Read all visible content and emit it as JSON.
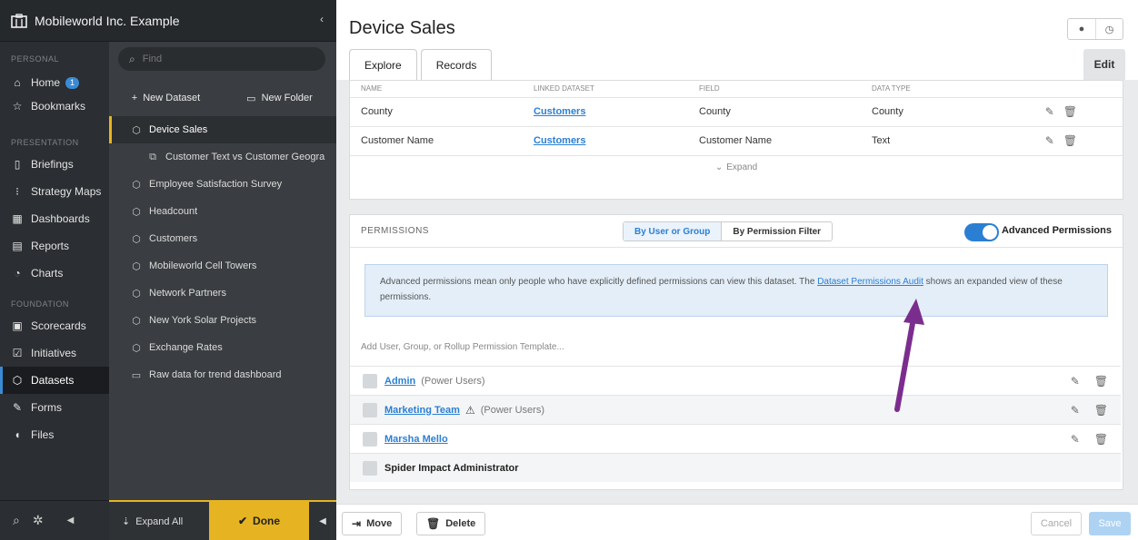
{
  "app": {
    "org_name": "Mobileworld Inc. Example"
  },
  "nav": {
    "sections": {
      "personal": "PERSONAL",
      "presentation": "PRESENTATION",
      "foundation": "FOUNDATION"
    },
    "items": [
      {
        "label": "Home",
        "icon": "home-icon",
        "badge": "1"
      },
      {
        "label": "Bookmarks",
        "icon": "star-icon"
      },
      {
        "label": "Briefings",
        "icon": "book-icon"
      },
      {
        "label": "Strategy Maps",
        "icon": "strategy-map-icon"
      },
      {
        "label": "Dashboards",
        "icon": "dashboard-icon"
      },
      {
        "label": "Reports",
        "icon": "report-icon"
      },
      {
        "label": "Charts",
        "icon": "chart-icon"
      },
      {
        "label": "Scorecards",
        "icon": "scorecard-icon"
      },
      {
        "label": "Initiatives",
        "icon": "checkbox-icon"
      },
      {
        "label": "Datasets",
        "icon": "dataset-icon",
        "active": true
      },
      {
        "label": "Forms",
        "icon": "form-icon"
      },
      {
        "label": "Files",
        "icon": "file-icon"
      }
    ]
  },
  "tree": {
    "search_placeholder": "Find",
    "new_dataset": "New Dataset",
    "new_folder": "New Folder",
    "items": [
      {
        "label": "Device Sales",
        "selected": true
      },
      {
        "label": "Customer Text vs Customer Geogra",
        "child": true
      },
      {
        "label": "Employee Satisfaction Survey"
      },
      {
        "label": "Headcount"
      },
      {
        "label": "Customers"
      },
      {
        "label": "Mobileworld Cell Towers"
      },
      {
        "label": "Network Partners"
      },
      {
        "label": "New York Solar Projects"
      },
      {
        "label": "Exchange Rates"
      },
      {
        "label": "Raw data for trend dashboard",
        "folder": true
      }
    ],
    "expand_all": "Expand All",
    "done": "Done"
  },
  "main": {
    "title": "Device Sales",
    "tabs": [
      "Explore",
      "Records"
    ],
    "edit": "Edit",
    "fields_table": {
      "columns": [
        "NAME",
        "LINKED DATASET",
        "FIELD",
        "DATA TYPE"
      ],
      "rows": [
        {
          "name": "County",
          "linked": "Customers",
          "field": "County",
          "type": "County"
        },
        {
          "name": "Customer Name",
          "linked": "Customers",
          "field": "Customer Name",
          "type": "Text"
        }
      ],
      "expand": "Expand"
    },
    "permissions": {
      "title": "PERMISSIONS",
      "by_user": "By User or Group",
      "by_filter": "By Permission Filter",
      "advanced_label": "Advanced Permissions",
      "advanced_on": true,
      "info_text_1": "Advanced permissions mean only people who have explicitly defined permissions can view this dataset. The ",
      "info_link": "Dataset Permissions Audit",
      "info_text_2": " shows an expanded view of these permissions.",
      "add_placeholder": "Add User, Group, or Rollup Permission Template...",
      "entries": [
        {
          "name": "Admin",
          "note": "(Power Users)"
        },
        {
          "name": "Marketing Team",
          "note": "(Power Users)",
          "warning": true
        },
        {
          "name": "Marsha Mello",
          "note": ""
        },
        {
          "name": "Spider Impact Administrator",
          "note": ""
        }
      ]
    },
    "footer": {
      "move": "Move",
      "delete": "Delete",
      "cancel": "Cancel",
      "save": "Save"
    }
  },
  "colors": {
    "accent_blue": "#2b7fd3",
    "accent_yellow": "#e6b422",
    "annotation_arrow": "#7b2d8e"
  }
}
